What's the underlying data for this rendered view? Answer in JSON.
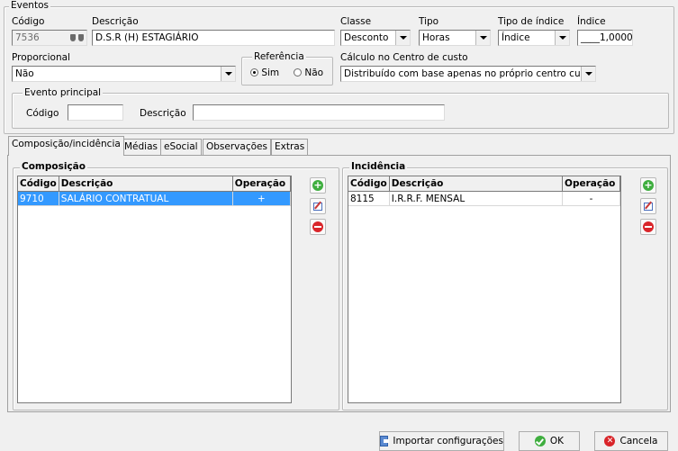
{
  "eventos": {
    "group_title": "Eventos",
    "codigo_label": "Código",
    "codigo_value": "7536",
    "descricao_label": "Descrição",
    "descricao_value": "D.S.R (H) ESTAGIÁRIO",
    "classe_label": "Classe",
    "classe_value": "Desconto",
    "tipo_label": "Tipo",
    "tipo_value": "Horas",
    "tipo_indice_label": "Tipo de índice",
    "tipo_indice_value": "Índice",
    "indice_label": "Índice",
    "indice_value": "____1,0000",
    "proporcional_label": "Proporcional",
    "proporcional_value": "Não",
    "referencia_title": "Referência",
    "referencia_sim": "Sim",
    "referencia_nao": "Não",
    "referencia_selected": "Sim",
    "calculo_label": "Cálculo no Centro de custo",
    "calculo_value": "Distribuído com base apenas no próprio centro custo",
    "evento_principal": {
      "title": "Evento principal",
      "codigo_label": "Código",
      "codigo_value": "",
      "descricao_label": "Descrição",
      "descricao_value": ""
    }
  },
  "tabs": [
    {
      "label": "Composição/incidência",
      "active": true
    },
    {
      "label": "Médias"
    },
    {
      "label": "eSocial"
    },
    {
      "label": "Observações"
    },
    {
      "label": "Extras"
    }
  ],
  "composicao": {
    "title": "Composição",
    "columns": [
      "Código",
      "Descrição",
      "Operação"
    ],
    "rows": [
      {
        "codigo": "9710",
        "descricao": "SALÁRIO CONTRATUAL",
        "operacao": "+"
      }
    ]
  },
  "incidencia": {
    "title": "Incidência",
    "columns": [
      "Código",
      "Descrição",
      "Operação"
    ],
    "rows": [
      {
        "codigo": "8115",
        "descricao": "I.R.R.F. MENSAL",
        "operacao": "-"
      }
    ]
  },
  "footer": {
    "importar_label": "Importar configurações",
    "ok_label": "OK",
    "cancelar_label": "Cancela"
  },
  "icons": {
    "add": "plus-circle-icon",
    "edit": "edit-icon",
    "delete": "minus-circle-icon",
    "search": "binoculars-icon"
  },
  "colors": {
    "selection": "#3399ff",
    "add_green": "#3fae3f",
    "delete_red": "#d9252a"
  }
}
